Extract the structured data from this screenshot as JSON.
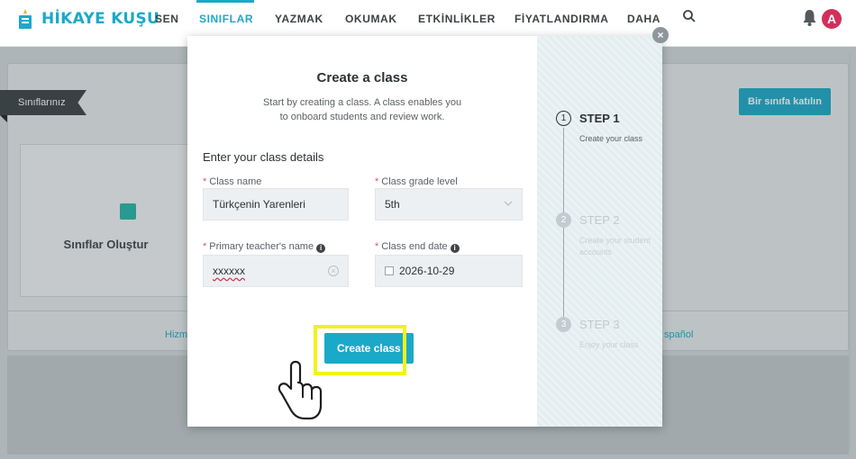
{
  "brand": {
    "name": "HİKAYE KUŞU",
    "color": "#1ba9c9"
  },
  "nav": {
    "items": [
      "SEN",
      "SINIFLAR",
      "YAZMAK",
      "OKUMAK",
      "ETKİNLİKLER",
      "FİYATLANDIRMA",
      "DAHA"
    ],
    "active": "SINIFLAR"
  },
  "user": {
    "avatar_initial": "A"
  },
  "background": {
    "ribbon_label": "Sınıflarınız",
    "join_button": "Bir sınıfa katılın",
    "create_card_label": "Sınıflar Oluştur",
    "footer_left": "Hizm",
    "footer_right": "spañol"
  },
  "modal": {
    "title": "Create a class",
    "description": "Start by creating a class. A class enables you to onboard students and review work.",
    "section_title": "Enter your class details",
    "fields": {
      "class_name": {
        "label": "Class name",
        "value": "Türkçenin Yarenleri"
      },
      "grade_level": {
        "label": "Class grade level",
        "value": "5th"
      },
      "teacher_name": {
        "label": "Primary teacher's name",
        "value": "xxxxxx"
      },
      "end_date": {
        "label": "Class end date",
        "value": "2026-10-29"
      }
    },
    "create_button": "Create class",
    "close_symbol": "×",
    "required_mark": "*",
    "info_symbol": "i"
  },
  "steps": [
    {
      "num": "1",
      "title": "STEP 1",
      "subtitle": "Create your class",
      "active": true
    },
    {
      "num": "2",
      "title": "STEP 2",
      "subtitle": "Create your student accounts",
      "active": false
    },
    {
      "num": "3",
      "title": "STEP 3",
      "subtitle": "Enjoy your class",
      "active": false
    }
  ],
  "colors": {
    "accent": "#1ba9c9",
    "highlight": "#f2f21a",
    "required": "#e0526b",
    "avatar": "#d32f5b"
  }
}
